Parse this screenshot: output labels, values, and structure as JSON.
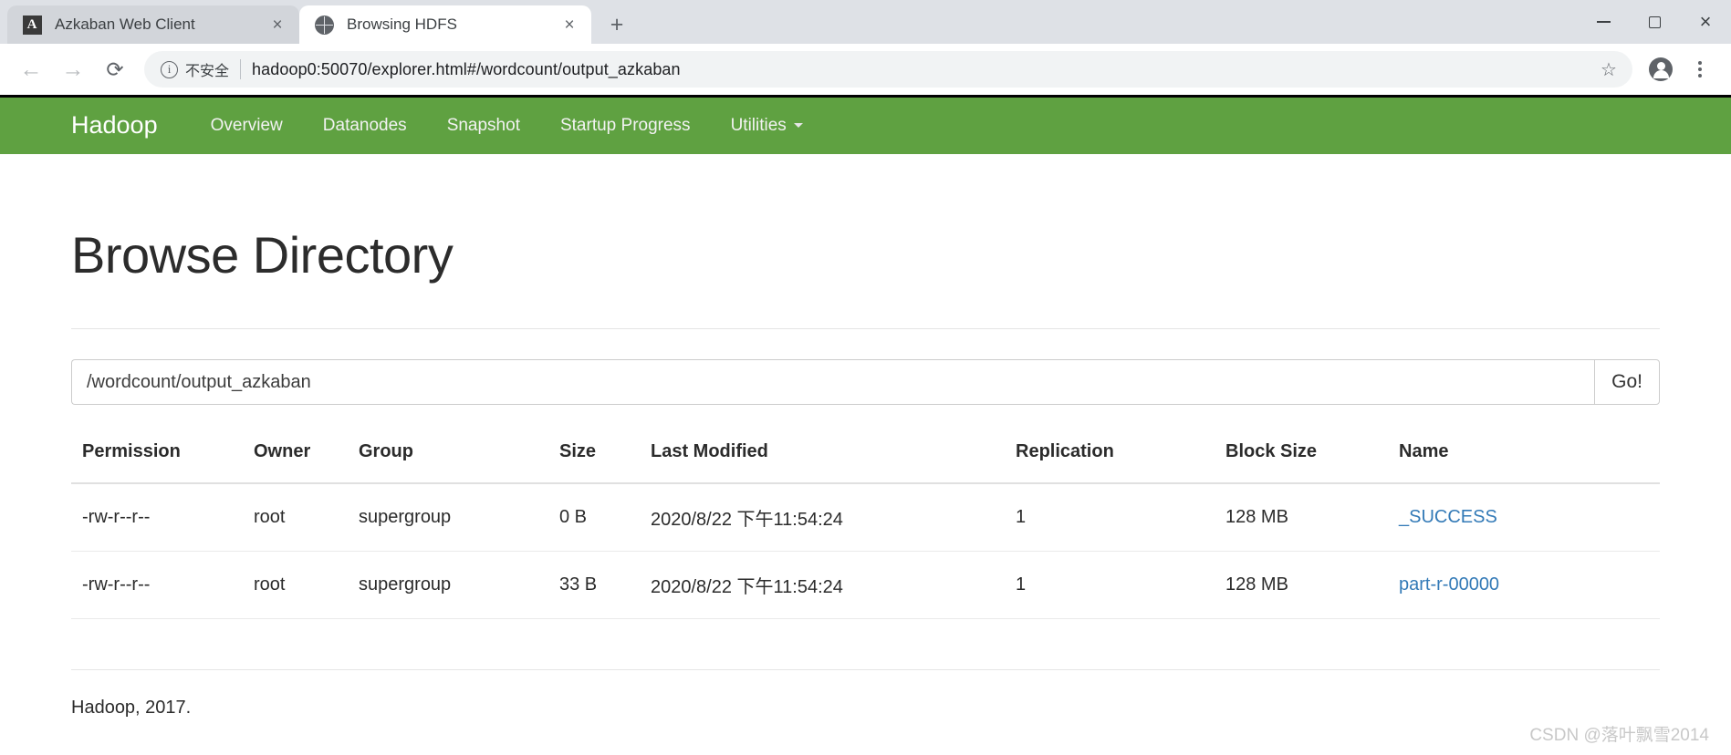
{
  "browser": {
    "tabs": [
      {
        "title": "Azkaban Web Client",
        "favicon": "azkaban-icon",
        "active": false,
        "close_label": "×"
      },
      {
        "title": "Browsing HDFS",
        "favicon": "globe-icon",
        "active": true,
        "close_label": "×"
      }
    ],
    "new_tab_label": "+",
    "window_controls": {
      "minimize": "minimize-icon",
      "maximize": "maximize-icon",
      "close": "×"
    },
    "toolbar": {
      "back_label": "←",
      "forward_label": "→",
      "reload_label": "⟳",
      "security_text": "不安全",
      "info_label": "i",
      "url": "hadoop0:50070/explorer.html#/wordcount/output_azkaban",
      "bookmark_label": "☆"
    }
  },
  "navbar": {
    "brand": "Hadoop",
    "links": [
      {
        "label": "Overview"
      },
      {
        "label": "Datanodes"
      },
      {
        "label": "Snapshot"
      },
      {
        "label": "Startup Progress"
      },
      {
        "label": "Utilities",
        "has_caret": true
      }
    ],
    "background_color": "#5FA141"
  },
  "page": {
    "title": "Browse Directory",
    "path_value": "/wordcount/output_azkaban",
    "path_placeholder": "",
    "go_label": "Go!",
    "footer": "Hadoop, 2017."
  },
  "table": {
    "headers": [
      "Permission",
      "Owner",
      "Group",
      "Size",
      "Last Modified",
      "Replication",
      "Block Size",
      "Name"
    ],
    "rows": [
      {
        "permission": "-rw-r--r--",
        "owner": "root",
        "group": "supergroup",
        "size": "0 B",
        "last_modified": "2020/8/22 下午11:54:24",
        "replication": "1",
        "block_size": "128 MB",
        "name": "_SUCCESS"
      },
      {
        "permission": "-rw-r--r--",
        "owner": "root",
        "group": "supergroup",
        "size": "33 B",
        "last_modified": "2020/8/22 下午11:54:24",
        "replication": "1",
        "block_size": "128 MB",
        "name": "part-r-00000"
      }
    ]
  },
  "watermark": "CSDN @落叶飘雪2014"
}
